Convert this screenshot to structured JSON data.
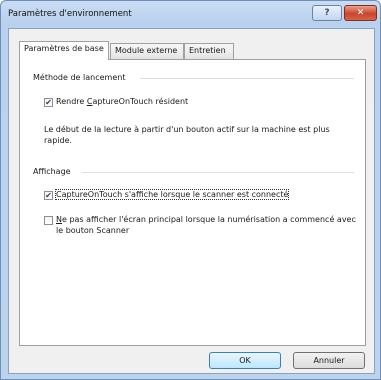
{
  "window": {
    "title": "Paramètres d'environnement",
    "help_label": "?",
    "close_label": "✕"
  },
  "tabs": [
    {
      "label": "Paramètres de base",
      "active": true
    },
    {
      "label": "Module externe",
      "active": false
    },
    {
      "label": "Entretien",
      "active": false
    }
  ],
  "launch": {
    "title": "Méthode de lancement",
    "resident": {
      "before": "Rendre ",
      "mnemonic": "C",
      "after": "aptureOnTouch résident",
      "checked": true
    },
    "description_line1": "Le début de la lecture à partir d'un bouton actif sur la machine est plus",
    "description_line2": "rapide."
  },
  "display": {
    "title": "Affichage",
    "show_on_connect": {
      "label": "CaptureOnTouch s'affiche lorsque le scanner est connecté",
      "checked": true
    },
    "hide_main": {
      "mnemonic": "N",
      "line1_rest": "e pas afficher l'écran principal lorsque la numérisation a commencé avec",
      "line2": "le bouton Scanner",
      "checked": false
    }
  },
  "buttons": {
    "ok": "OK",
    "cancel": "Annuler"
  }
}
